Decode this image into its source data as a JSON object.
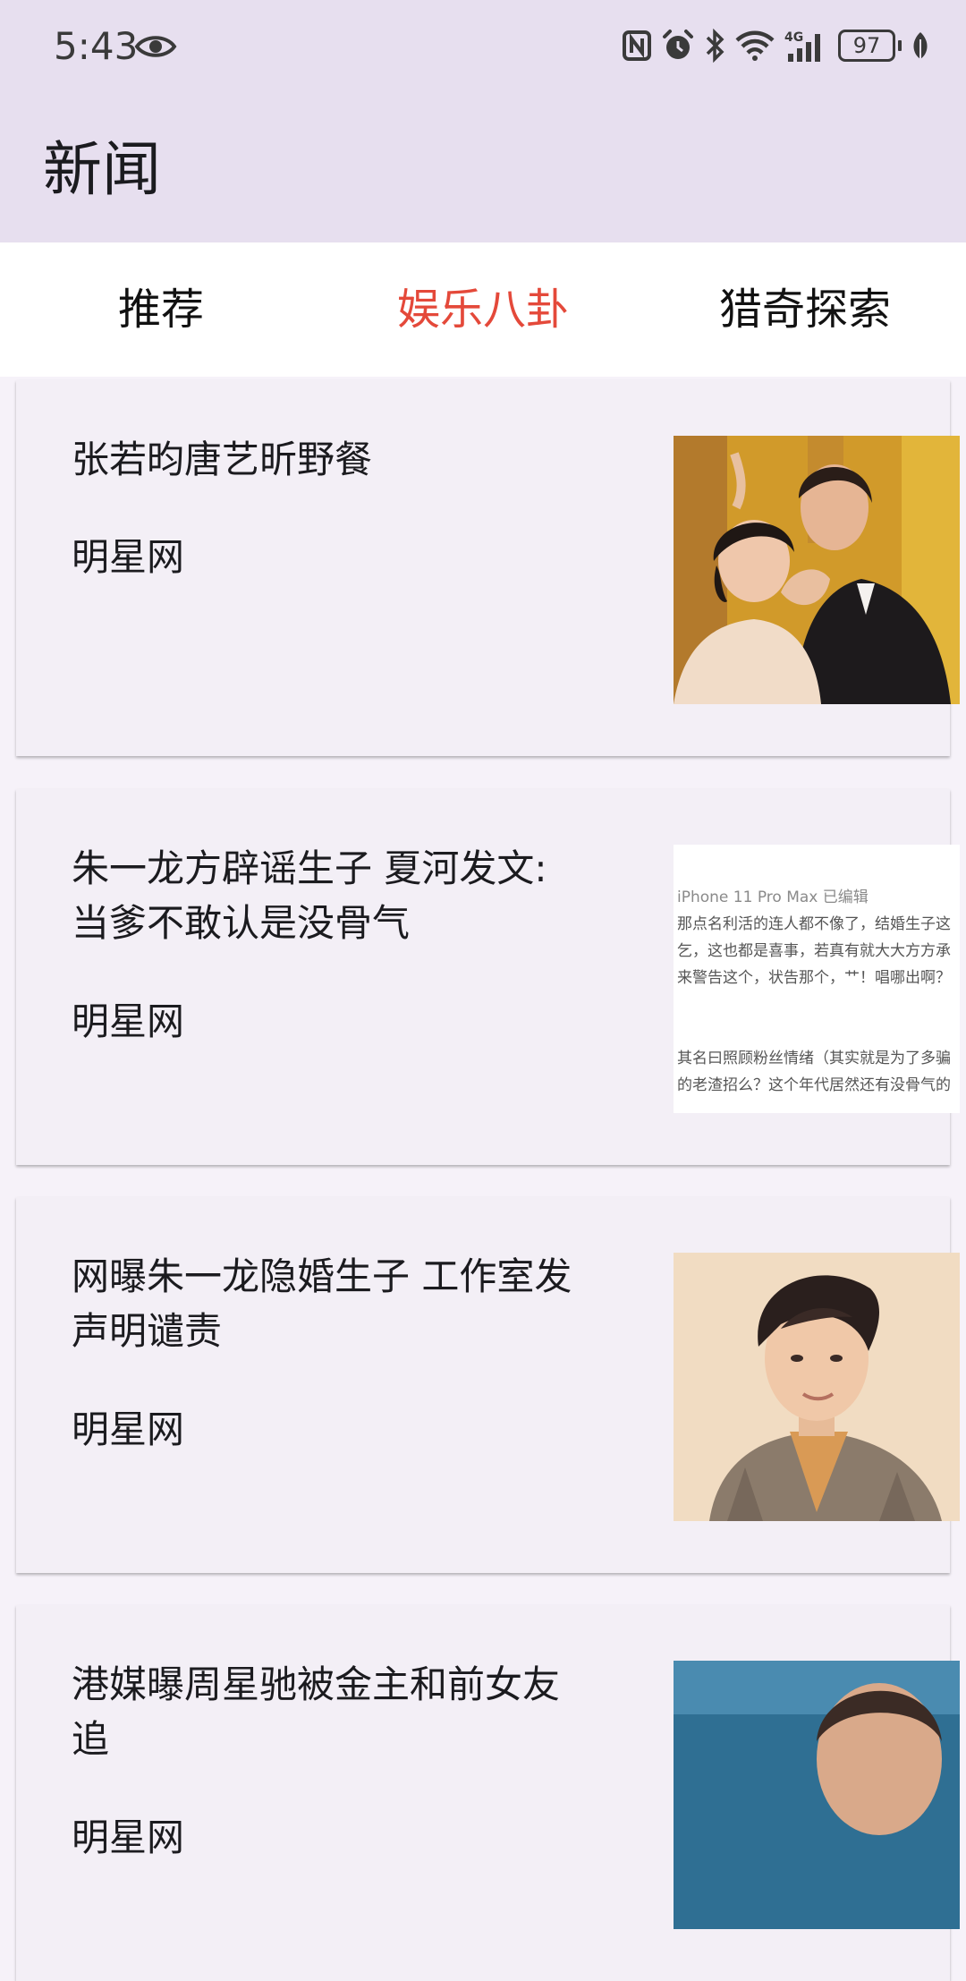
{
  "status_bar": {
    "time": "5:43",
    "battery_level": "97"
  },
  "app_bar": {
    "title": "新闻"
  },
  "tabs": [
    {
      "label": "推荐",
      "active": false
    },
    {
      "label": "娱乐八卦",
      "active": true
    },
    {
      "label": "猎奇探索",
      "active": false
    }
  ],
  "accent_color": "#e4493a",
  "news": [
    {
      "title": "张若昀唐艺昕野餐",
      "source": "明星网",
      "image": "couple-photo"
    },
    {
      "title": "朱一龙方辟谣生子 夏河发文:当爹不敢认是没骨气",
      "source": "明星网",
      "image": "text-screenshot",
      "image_lines": [
        "iPhone 11 Pro Max   已编辑",
        "那点名利活的连人都不像了，结婚生子这",
        "乞，这也都是喜事，若真有就大大方方承",
        "来警告这个，状告那个，艹！唱哪出啊？",
        "其名曰照顾粉丝情绪（其实就是为了多骗",
        "的老渣招么？这个年代居然还有没骨气的"
      ]
    },
    {
      "title": "网曝朱一龙隐婚生子 工作室发声明谴责",
      "source": "明星网",
      "image": "portrait-photo"
    },
    {
      "title": "港媒曝周星驰被金主和前女友追",
      "source": "明星网",
      "image": "portrait-photo-2"
    }
  ]
}
